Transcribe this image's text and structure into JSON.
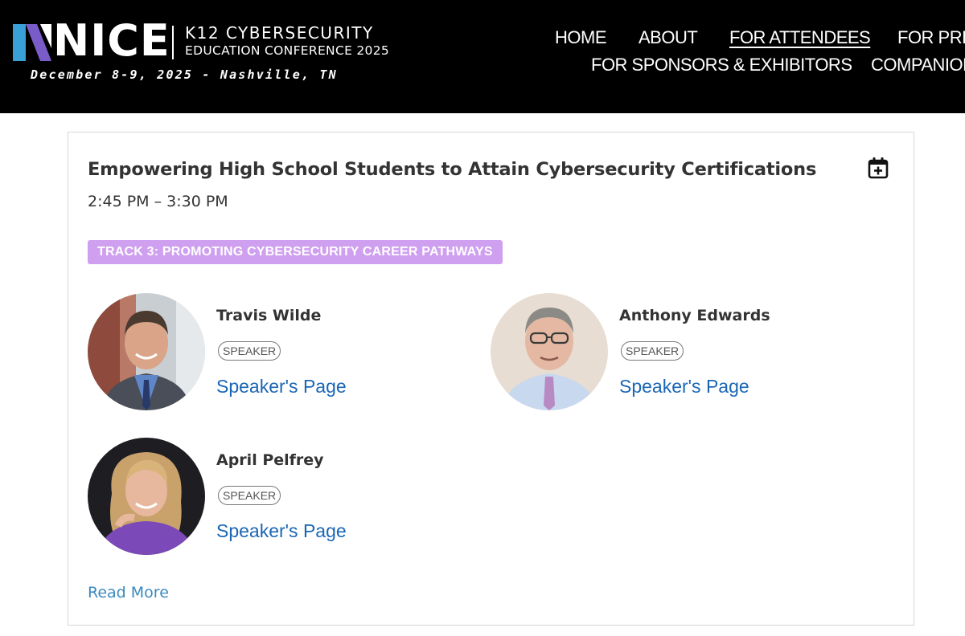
{
  "header": {
    "logo_word": "NICE",
    "logo_line1": "K12 CYBERSECURITY",
    "logo_line2": "EDUCATION CONFERENCE 2025",
    "dateline": "December 8-9, 2025 - Nashville, TN",
    "nav": [
      {
        "label": "HOME",
        "active": false
      },
      {
        "label": "ABOUT",
        "active": false
      },
      {
        "label": "FOR ATTENDEES",
        "active": true
      },
      {
        "label": "FOR PRE",
        "active": false
      },
      {
        "label": "FOR SPONSORS & EXHIBITORS",
        "active": false
      },
      {
        "label": "COMPANION",
        "active": false
      }
    ]
  },
  "session": {
    "title": "Empowering High School Students to Attain Cybersecurity Certifications",
    "time": "2:45 PM – 3:30 PM",
    "track": "TRACK 3: PROMOTING CYBERSECURITY CAREER PATHWAYS",
    "calendar_icon": "calendar-add-icon",
    "speakers": [
      {
        "name": "Travis Wilde",
        "role": "SPEAKER",
        "link": "Speaker's Page"
      },
      {
        "name": "Anthony Edwards",
        "role": "SPEAKER",
        "link": "Speaker's Page"
      },
      {
        "name": "April Pelfrey",
        "role": "SPEAKER",
        "link": "Speaker's Page"
      }
    ],
    "read_more": "Read More"
  },
  "colors": {
    "header_bg": "#000000",
    "track_badge": "#cf9ff0",
    "link": "#1a66b5",
    "read_more": "#3a8ac0",
    "logo_blue": "#3aa0d8",
    "logo_purple": "#7a5cc8"
  }
}
